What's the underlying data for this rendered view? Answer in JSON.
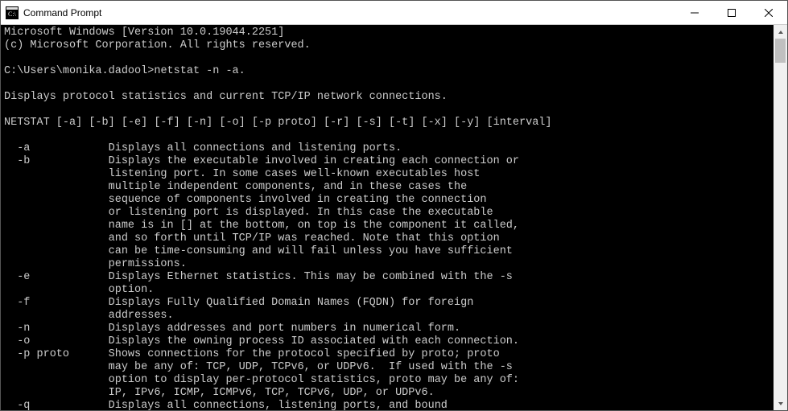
{
  "window": {
    "title": "Command Prompt"
  },
  "terminal": {
    "banner1": "Microsoft Windows [Version 10.0.19044.2251]",
    "banner2": "(c) Microsoft Corporation. All rights reserved.",
    "prompt_path": "C:\\Users\\monika.dadool>",
    "command": "netstat -n -a.",
    "desc": "Displays protocol statistics and current TCP/IP network connections.",
    "usage": "NETSTAT [-a] [-b] [-e] [-f] [-n] [-o] [-p proto] [-r] [-s] [-t] [-x] [-y] [interval]",
    "opts": {
      "a": {
        "flag": "-a",
        "l1": "Displays all connections and listening ports."
      },
      "b": {
        "flag": "-b",
        "l1": "Displays the executable involved in creating each connection or",
        "l2": "listening port. In some cases well-known executables host",
        "l3": "multiple independent components, and in these cases the",
        "l4": "sequence of components involved in creating the connection",
        "l5": "or listening port is displayed. In this case the executable",
        "l6": "name is in [] at the bottom, on top is the component it called,",
        "l7": "and so forth until TCP/IP was reached. Note that this option",
        "l8": "can be time-consuming and will fail unless you have sufficient",
        "l9": "permissions."
      },
      "e": {
        "flag": "-e",
        "l1": "Displays Ethernet statistics. This may be combined with the -s",
        "l2": "option."
      },
      "f": {
        "flag": "-f",
        "l1": "Displays Fully Qualified Domain Names (FQDN) for foreign",
        "l2": "addresses."
      },
      "n": {
        "flag": "-n",
        "l1": "Displays addresses and port numbers in numerical form."
      },
      "o": {
        "flag": "-o",
        "l1": "Displays the owning process ID associated with each connection."
      },
      "p": {
        "flag": "-p proto",
        "l1": "Shows connections for the protocol specified by proto; proto",
        "l2": "may be any of: TCP, UDP, TCPv6, or UDPv6.  If used with the -s",
        "l3": "option to display per-protocol statistics, proto may be any of:",
        "l4": "IP, IPv6, ICMP, ICMPv6, TCP, TCPv6, UDP, or UDPv6."
      },
      "q": {
        "flag": "-q",
        "l1": "Displays all connections, listening ports, and bound"
      }
    }
  }
}
